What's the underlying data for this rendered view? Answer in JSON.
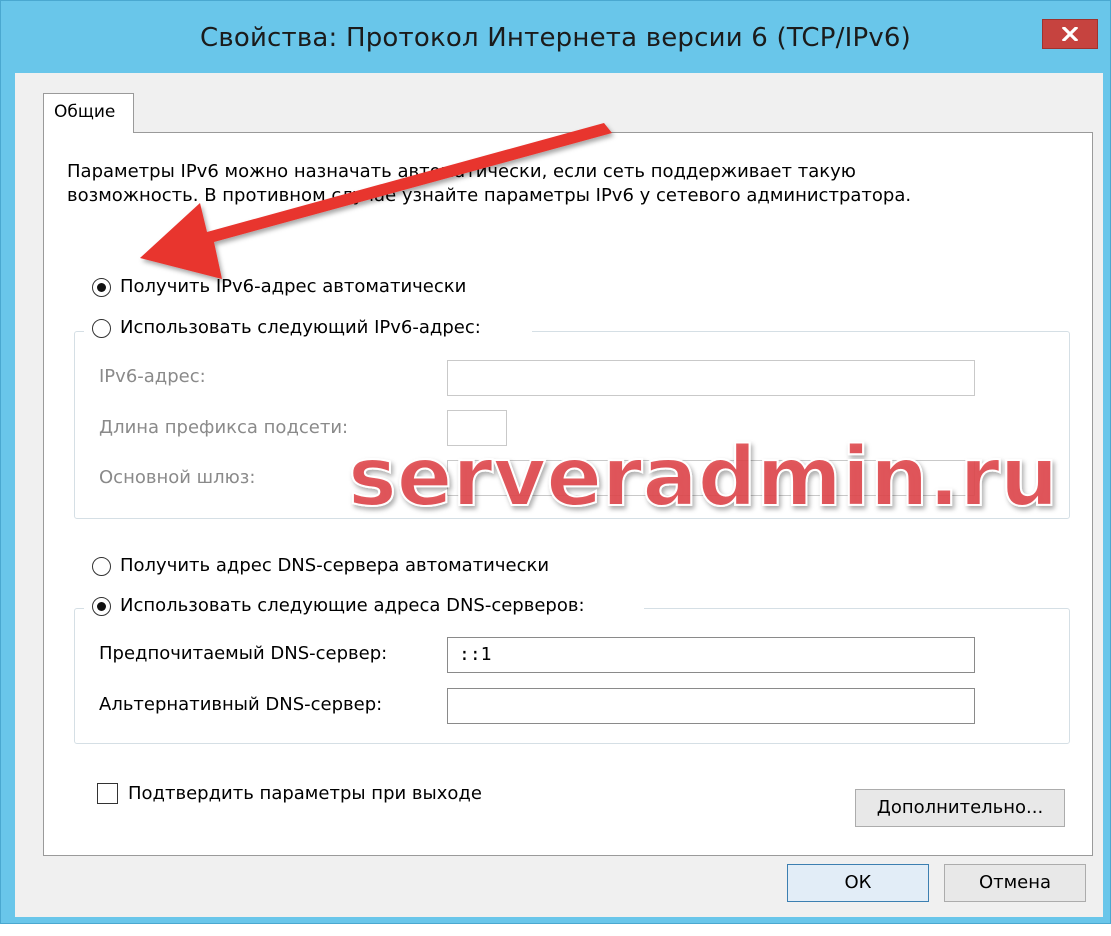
{
  "window": {
    "title": "Свойства: Протокол Интернета версии 6 (TCP/IPv6)",
    "close_icon": "close-x-icon",
    "frame_color": "#69c6ea",
    "close_color": "#c6433f"
  },
  "tabs": [
    {
      "label": "Общие",
      "selected": true
    }
  ],
  "intro": {
    "line1": "Параметры IPv6 можно назначать автоматически, если сеть поддерживает такую",
    "line2": "возможность. В противном случае узнайте параметры IPv6 у сетевого администратора."
  },
  "address": {
    "auto_label": "Получить IPv6-адрес автоматически",
    "manual_label": "Использовать следующий IPv6-адрес:",
    "selected": "auto",
    "fields": [
      {
        "label": "IPv6-адрес:",
        "value": ""
      },
      {
        "label": "Длина префикса подсети:",
        "value": ""
      },
      {
        "label": "Основной шлюз:",
        "value": ""
      }
    ]
  },
  "dns": {
    "auto_label": "Получить адрес DNS-сервера автоматически",
    "manual_label": "Использовать следующие адреса DNS-серверов:",
    "selected": "manual",
    "preferred_label": "Предпочитаемый DNS-сервер:",
    "preferred_value": "::1",
    "alternate_label": "Альтернативный DNS-сервер:",
    "alternate_value": ""
  },
  "validate": {
    "label": "Подтвердить параметры при выходе",
    "checked": false
  },
  "buttons": {
    "advanced": "Дополнительно...",
    "ok": "ОК",
    "cancel": "Отмена"
  },
  "annotation": {
    "watermark": "serveradmin.ru",
    "watermark_color": "#e0474c",
    "arrow_color": "#e8342f",
    "arrow_icon": "red-arrow-icon"
  }
}
